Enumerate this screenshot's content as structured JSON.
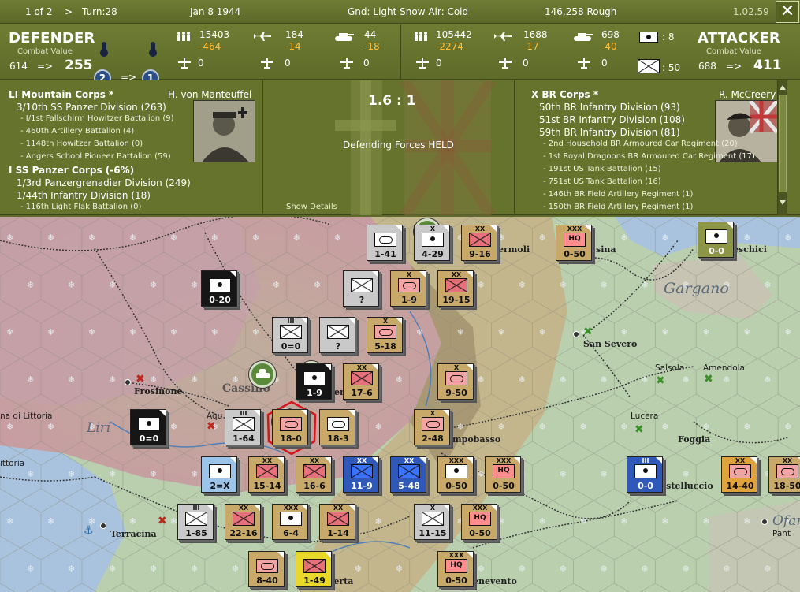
{
  "topbar": {
    "page": "1 of 2",
    "turn_arrow": ">",
    "turn": "Turn:28",
    "date": "Jan 8 1944",
    "weather": "Gnd: Light Snow  Air: Cold",
    "terrain_info": "146,258  Rough",
    "version": "1.02.59",
    "close": "✕"
  },
  "defender": {
    "title": "DEFENDER",
    "cv_label": "Combat Value",
    "cv_from": "614",
    "arrow": "=>",
    "cv_to": "255",
    "round_from": "2",
    "round_arrow": "=>",
    "round_to": "1",
    "men": "15403",
    "men_loss": "-464",
    "air1": "184",
    "air1_loss": "-14",
    "tanks": "44",
    "tanks_loss": "-18",
    "guns": "0",
    "air2": "0",
    "art": "0"
  },
  "attacker": {
    "title": "ATTACKER",
    "cv_label": "Combat Value",
    "cv_from": "688",
    "arrow": "=>",
    "cv_to": "411",
    "men": "105442",
    "men_loss": "-2274",
    "air1": "1688",
    "air1_loss": "-17",
    "tanks": "698",
    "tanks_loss": "-40",
    "guns": "0",
    "air2": "0",
    "art": "0",
    "supply_count": ": 8",
    "hq_count": ": 50"
  },
  "defender_units": {
    "commander": "H. von Manteuffel",
    "lines": [
      {
        "text": "LI Mountain Corps *",
        "kind": "corps"
      },
      {
        "text": "3/10th SS Panzer Division (263)",
        "kind": "div"
      },
      {
        "text": "- I/1st Fallschirm Howitzer Battalion (9)",
        "kind": "bat"
      },
      {
        "text": "- 460th Artillery Battalion (4)",
        "kind": "bat"
      },
      {
        "text": "- 1148th Howitzer Battalion (0)",
        "kind": "bat"
      },
      {
        "text": "- Angers School Pioneer Battalion (59)",
        "kind": "bat"
      },
      {
        "text": "I SS Panzer Corps (-6%)",
        "kind": "corps"
      },
      {
        "text": "1/3rd Panzergrenadier Division (249)",
        "kind": "div"
      },
      {
        "text": "1/44th Infantry Division (18)",
        "kind": "div"
      },
      {
        "text": "- 116th Light Flak Battalion (0)",
        "kind": "bat"
      }
    ]
  },
  "result": {
    "ratio": "1.6 : 1",
    "text": "Defending Forces HELD",
    "details": "Show Details"
  },
  "attacker_units": {
    "commander": "R. McCreery",
    "lines": [
      {
        "text": "X BR Corps *",
        "kind": "corps"
      },
      {
        "text": "50th BR Infantry Division (93)",
        "kind": "div"
      },
      {
        "text": "51st BR Infantry Division (108)",
        "kind": "div"
      },
      {
        "text": "59th BR Infantry Division (81)",
        "kind": "div"
      },
      {
        "text": "- 2nd Household BR Armoured Car Regiment (20)",
        "kind": "bat"
      },
      {
        "text": "- 1st Royal Dragoons BR Armoured Car Regiment (17)",
        "kind": "bat"
      },
      {
        "text": "- 191st US Tank Battalion (15)",
        "kind": "bat"
      },
      {
        "text": "- 751st US Tank Battalion (16)",
        "kind": "bat"
      },
      {
        "text": "- 146th BR Field Artillery Regiment (1)",
        "kind": "bat"
      },
      {
        "text": "- 150th BR Field Artillery Regiment (1)",
        "kind": "bat"
      }
    ]
  },
  "map": {
    "regions": [
      "Gargano",
      "Liri",
      "Ofan"
    ],
    "towns": [
      "Frosinone",
      "Cassino",
      "Aqu",
      "na di Littoria",
      "ittoria",
      "Terracina",
      "ermoli",
      "sina",
      "eschici",
      "San Severo",
      "Salsola",
      "Amendola",
      "Lucera",
      "Foggia",
      "mpobasso",
      "astelluccio",
      "Pant",
      "enevento",
      "aserta",
      "er"
    ],
    "counters": [
      {
        "size": "",
        "value": "1-41"
      },
      {
        "size": "X",
        "value": "4-29"
      },
      {
        "size": "XX",
        "value": "9-16"
      },
      {
        "size": "XXX",
        "value": "0-50"
      },
      {
        "size": "",
        "value": "0-0"
      },
      {
        "size": "",
        "value": "0-20"
      },
      {
        "size": "",
        "value": "?"
      },
      {
        "size": "X",
        "value": "1-9"
      },
      {
        "size": "XX",
        "value": "19-15"
      },
      {
        "size": "III",
        "value": "0=0"
      },
      {
        "size": "",
        "value": "?"
      },
      {
        "size": "X",
        "value": "5-18"
      },
      {
        "size": "",
        "value": "1-9"
      },
      {
        "size": "XX",
        "value": "17-6"
      },
      {
        "size": "X",
        "value": "9-50"
      },
      {
        "size": "",
        "value": "0=0"
      },
      {
        "size": "III",
        "value": "1-64"
      },
      {
        "size": "",
        "value": "18-0"
      },
      {
        "size": "",
        "value": "18-3"
      },
      {
        "size": "X",
        "value": "2-48"
      },
      {
        "size": "",
        "value": "2=X"
      },
      {
        "size": "XX",
        "value": "15-14"
      },
      {
        "size": "XX",
        "value": "16-6"
      },
      {
        "size": "XX",
        "value": "11-9"
      },
      {
        "size": "XX",
        "value": "5-48"
      },
      {
        "size": "XXX",
        "value": "0-50"
      },
      {
        "size": "XXX",
        "value": "0-50"
      },
      {
        "size": "III",
        "value": "0-0"
      },
      {
        "size": "XX",
        "value": "14-40"
      },
      {
        "size": "XX",
        "value": "18-50"
      },
      {
        "size": "III",
        "value": "1-85"
      },
      {
        "size": "XX",
        "value": "22-16"
      },
      {
        "size": "XXX",
        "value": "6-4"
      },
      {
        "size": "XX",
        "value": "1-14"
      },
      {
        "size": "X",
        "value": "11-15"
      },
      {
        "size": "XXX",
        "value": "0-50"
      },
      {
        "size": "",
        "value": "8-40"
      },
      {
        "size": "",
        "value": "1-49"
      },
      {
        "size": "XXX",
        "value": "0-50"
      }
    ]
  },
  "colors": {
    "bg": "#66732d",
    "loss": "#ffbf3a",
    "axis_counter": "#c8a96a",
    "allied_counter": "#2f58b8"
  }
}
